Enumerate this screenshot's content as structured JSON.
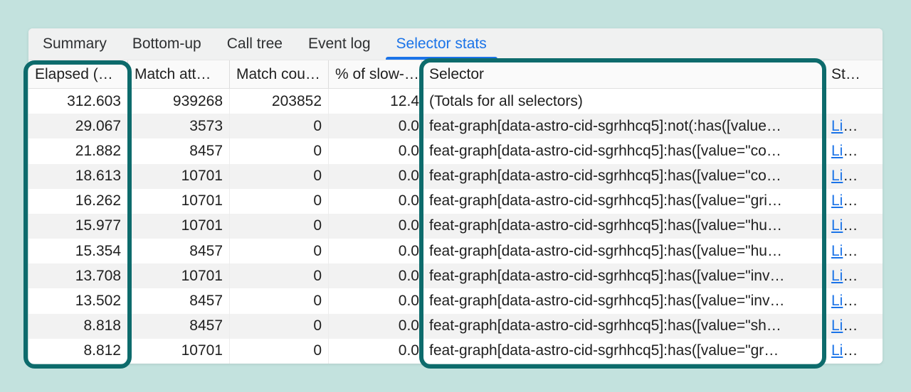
{
  "colors": {
    "page_bg": "#c3e2de",
    "annotation": "#0d6b6c",
    "accent_blue": "#1a73e8",
    "link": "#1a73e8",
    "text": "#1f1f1f",
    "tabbar_bg": "#f0f1f1",
    "header_bg": "#fafafa",
    "zebra": "#f2f2f2"
  },
  "tabs": {
    "items": [
      {
        "label": "Summary",
        "active": false
      },
      {
        "label": "Bottom-up",
        "active": false
      },
      {
        "label": "Call tree",
        "active": false
      },
      {
        "label": "Event log",
        "active": false
      },
      {
        "label": "Selector stats",
        "active": true
      }
    ]
  },
  "table": {
    "columns": [
      "Elapsed (…",
      "Match att…",
      "Match cou…",
      "% of slow-…",
      "Selector",
      "St…"
    ],
    "rows": [
      {
        "elapsed": "312.603",
        "match_attempts": "939268",
        "match_count": "203852",
        "slow_pct": "12.4",
        "selector": "(Totals for all selectors)",
        "link": "",
        "trunc": ""
      },
      {
        "elapsed": "29.067",
        "match_attempts": "3573",
        "match_count": "0",
        "slow_pct": "0.0",
        "selector": "feat-graph[data-astro-cid-sgrhhcq5]:not(:has([value…",
        "link": "Li",
        "trunc": "…"
      },
      {
        "elapsed": "21.882",
        "match_attempts": "8457",
        "match_count": "0",
        "slow_pct": "0.0",
        "selector": "feat-graph[data-astro-cid-sgrhhcq5]:has([value=\"co…",
        "link": "Li",
        "trunc": "…"
      },
      {
        "elapsed": "18.613",
        "match_attempts": "10701",
        "match_count": "0",
        "slow_pct": "0.0",
        "selector": "feat-graph[data-astro-cid-sgrhhcq5]:has([value=\"co…",
        "link": "Li",
        "trunc": "…"
      },
      {
        "elapsed": "16.262",
        "match_attempts": "10701",
        "match_count": "0",
        "slow_pct": "0.0",
        "selector": "feat-graph[data-astro-cid-sgrhhcq5]:has([value=\"gri…",
        "link": "Li",
        "trunc": "…"
      },
      {
        "elapsed": "15.977",
        "match_attempts": "10701",
        "match_count": "0",
        "slow_pct": "0.0",
        "selector": "feat-graph[data-astro-cid-sgrhhcq5]:has([value=\"hu…",
        "link": "Li",
        "trunc": "…"
      },
      {
        "elapsed": "15.354",
        "match_attempts": "8457",
        "match_count": "0",
        "slow_pct": "0.0",
        "selector": "feat-graph[data-astro-cid-sgrhhcq5]:has([value=\"hu…",
        "link": "Li",
        "trunc": "…"
      },
      {
        "elapsed": "13.708",
        "match_attempts": "10701",
        "match_count": "0",
        "slow_pct": "0.0",
        "selector": "feat-graph[data-astro-cid-sgrhhcq5]:has([value=\"inv…",
        "link": "Li",
        "trunc": "…"
      },
      {
        "elapsed": "13.502",
        "match_attempts": "8457",
        "match_count": "0",
        "slow_pct": "0.0",
        "selector": "feat-graph[data-astro-cid-sgrhhcq5]:has([value=\"inv…",
        "link": "Li",
        "trunc": "…"
      },
      {
        "elapsed": "8.818",
        "match_attempts": "8457",
        "match_count": "0",
        "slow_pct": "0.0",
        "selector": "feat-graph[data-astro-cid-sgrhhcq5]:has([value=\"sh…",
        "link": "Li",
        "trunc": "…"
      },
      {
        "elapsed": "8.812",
        "match_attempts": "10701",
        "match_count": "0",
        "slow_pct": "0.0",
        "selector": "feat-graph[data-astro-cid-sgrhhcq5]:has([value=\"gr…",
        "link": "Li",
        "trunc": "…"
      }
    ]
  }
}
